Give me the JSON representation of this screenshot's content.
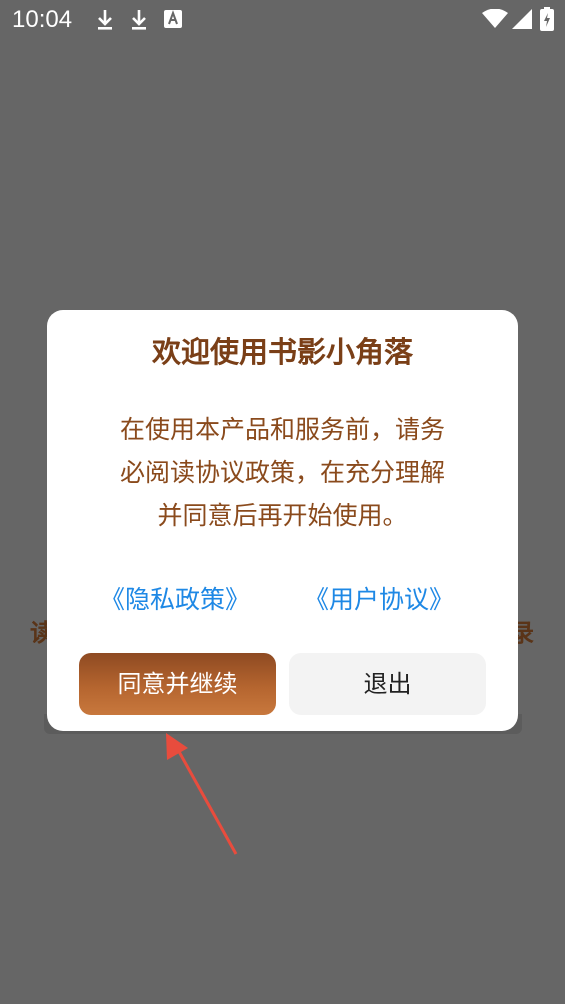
{
  "status_bar": {
    "time": "10:04",
    "left_icons": [
      "download-icon",
      "download-icon",
      "font-a-icon"
    ],
    "right_icons": [
      "wifi-icon",
      "signal-icon",
      "battery-icon"
    ]
  },
  "background": {
    "left_char": "读",
    "right_char": "录"
  },
  "dialog": {
    "title": "欢迎使用书影小角落",
    "body_lines": [
      "在使用本产品和服务前，请务",
      "必阅读协议政策，在充分理解",
      "并同意后再开始使用。"
    ],
    "privacy_link": "《隐私政策》",
    "user_agreement_link": "《用户协议》",
    "agree_button": "同意并继续",
    "exit_button": "退出"
  },
  "colors": {
    "overlay": "#666666",
    "title": "#7a3f17",
    "body": "#8a4a1c",
    "link": "#1e88e5",
    "agree_button": "#b5652f",
    "exit_button": "#f3f3f3",
    "arrow": "#e84c3d"
  }
}
